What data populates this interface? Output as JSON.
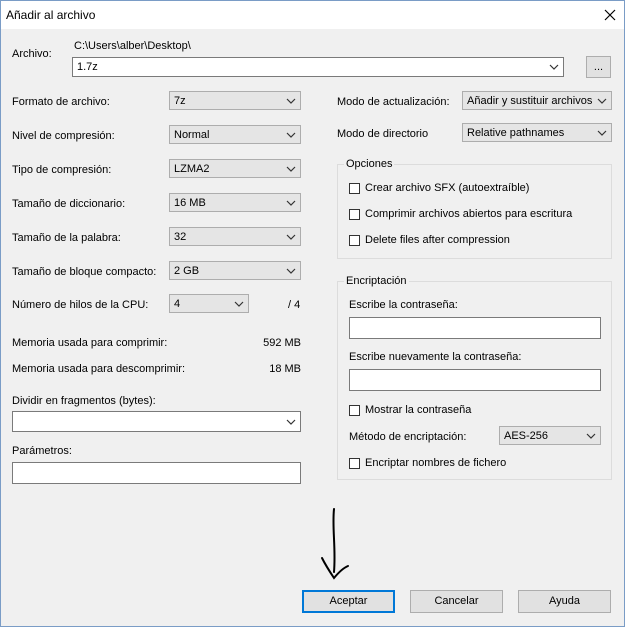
{
  "window": {
    "title": "Añadir al archivo"
  },
  "archive": {
    "label": "Archivo:",
    "path": "C:\\Users\\alber\\Desktop\\",
    "name": "1.7z",
    "browse_label": "..."
  },
  "left": {
    "format": {
      "label": "Formato de archivo:",
      "value": "7z"
    },
    "level": {
      "label": "Nivel de compresión:",
      "value": "Normal"
    },
    "method": {
      "label": "Tipo de compresión:",
      "value": "LZMA2"
    },
    "dict": {
      "label": "Tamaño de diccionario:",
      "value": "16 MB"
    },
    "word": {
      "label": "Tamaño de la palabra:",
      "value": "32"
    },
    "solid": {
      "label": "Tamaño de bloque compacto:",
      "value": "2 GB"
    },
    "threads": {
      "label": "Número de hilos de la CPU:",
      "value": "4",
      "max": "/ 4"
    },
    "mem_compress": {
      "label": "Memoria usada para comprimir:",
      "value": "592 MB"
    },
    "mem_decompress": {
      "label": "Memoria usada para descomprimir:",
      "value": "18 MB"
    },
    "split": {
      "label": "Dividir en fragmentos (bytes):",
      "value": ""
    },
    "params": {
      "label": "Parámetros:",
      "value": ""
    }
  },
  "right": {
    "update_mode": {
      "label": "Modo de actualización:",
      "value": "Añadir y sustituir archivos"
    },
    "path_mode": {
      "label": "Modo de directorio",
      "value": "Relative pathnames"
    },
    "options": {
      "legend": "Opciones",
      "sfx": "Crear archivo SFX (autoextraíble)",
      "shared": "Comprimir archivos abiertos para escritura",
      "delete": "Delete files after compression"
    },
    "encryption": {
      "legend": "Encriptación",
      "password_label": "Escribe la contraseña:",
      "repeat_label": "Escribe nuevamente la contraseña:",
      "show_password": "Mostrar la contraseña",
      "method_label": "Método de encriptación:",
      "method_value": "AES-256",
      "encrypt_names": "Encriptar nombres de fichero"
    }
  },
  "buttons": {
    "ok": "Aceptar",
    "cancel": "Cancelar",
    "help": "Ayuda"
  }
}
